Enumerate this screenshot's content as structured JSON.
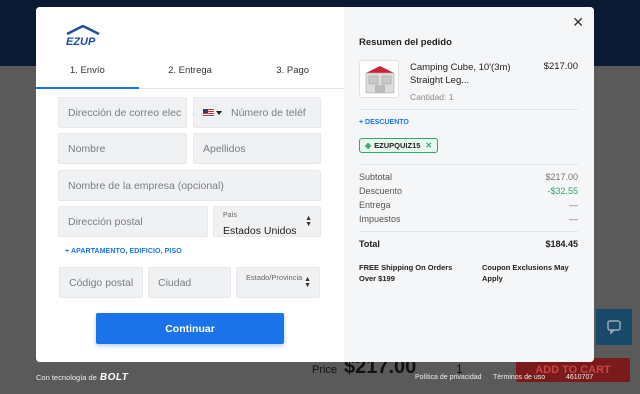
{
  "background": {
    "price_label": "Price",
    "price_value": "$217.00",
    "qty": "1",
    "add_to_cart": "ADD TO CART"
  },
  "brand": {
    "logo_text": "EZUP"
  },
  "tabs": [
    {
      "label": "1. Envío",
      "active": true
    },
    {
      "label": "2. Entrega",
      "active": false
    },
    {
      "label": "3. Pago",
      "active": false
    }
  ],
  "form": {
    "email_placeholder": "Dirección de correo elec",
    "phone_placeholder": "Número de teléf",
    "first_name_placeholder": "Nombre",
    "last_name_placeholder": "Apellidos",
    "company_placeholder": "Nombre de la empresa (opcional)",
    "address_placeholder": "Dirección postal",
    "country_label": "País",
    "country_value": "Estados Unidos",
    "apartment_link": "+ APARTAMENTO, EDIFICIO, PISO",
    "postal_placeholder": "Código postal",
    "city_placeholder": "Ciudad",
    "state_label": "Estado/Provincia",
    "continue_label": "Continuar"
  },
  "order": {
    "title": "Resumen del pedido",
    "product_name": "Camping Cube, 10'(3m) Straight Leg...",
    "product_qty": "Cantidad: 1",
    "product_price": "$217.00",
    "discount_link": "+ DESCUENTO",
    "coupon_code": "EZUPQUIZ15",
    "rows": [
      {
        "label": "Subtotal",
        "value": "$217.00"
      },
      {
        "label": "Descuento",
        "value": "-$32.55"
      },
      {
        "label": "Entrega",
        "value": "—"
      },
      {
        "label": "Impuestos",
        "value": "—"
      }
    ],
    "total_label": "Total",
    "total_value": "$184.45",
    "note_left": "FREE Shipping On Orders Over $199",
    "note_right": "Coupon Exclusions May Apply"
  },
  "footer": {
    "powered_by": "Con tecnología de",
    "powered_brand": "BOLT",
    "privacy": "Política de privacidad",
    "terms": "Términos de uso",
    "order_id": "4610707"
  },
  "colors": {
    "accent": "#1a73e8",
    "success": "#2fa86a"
  }
}
